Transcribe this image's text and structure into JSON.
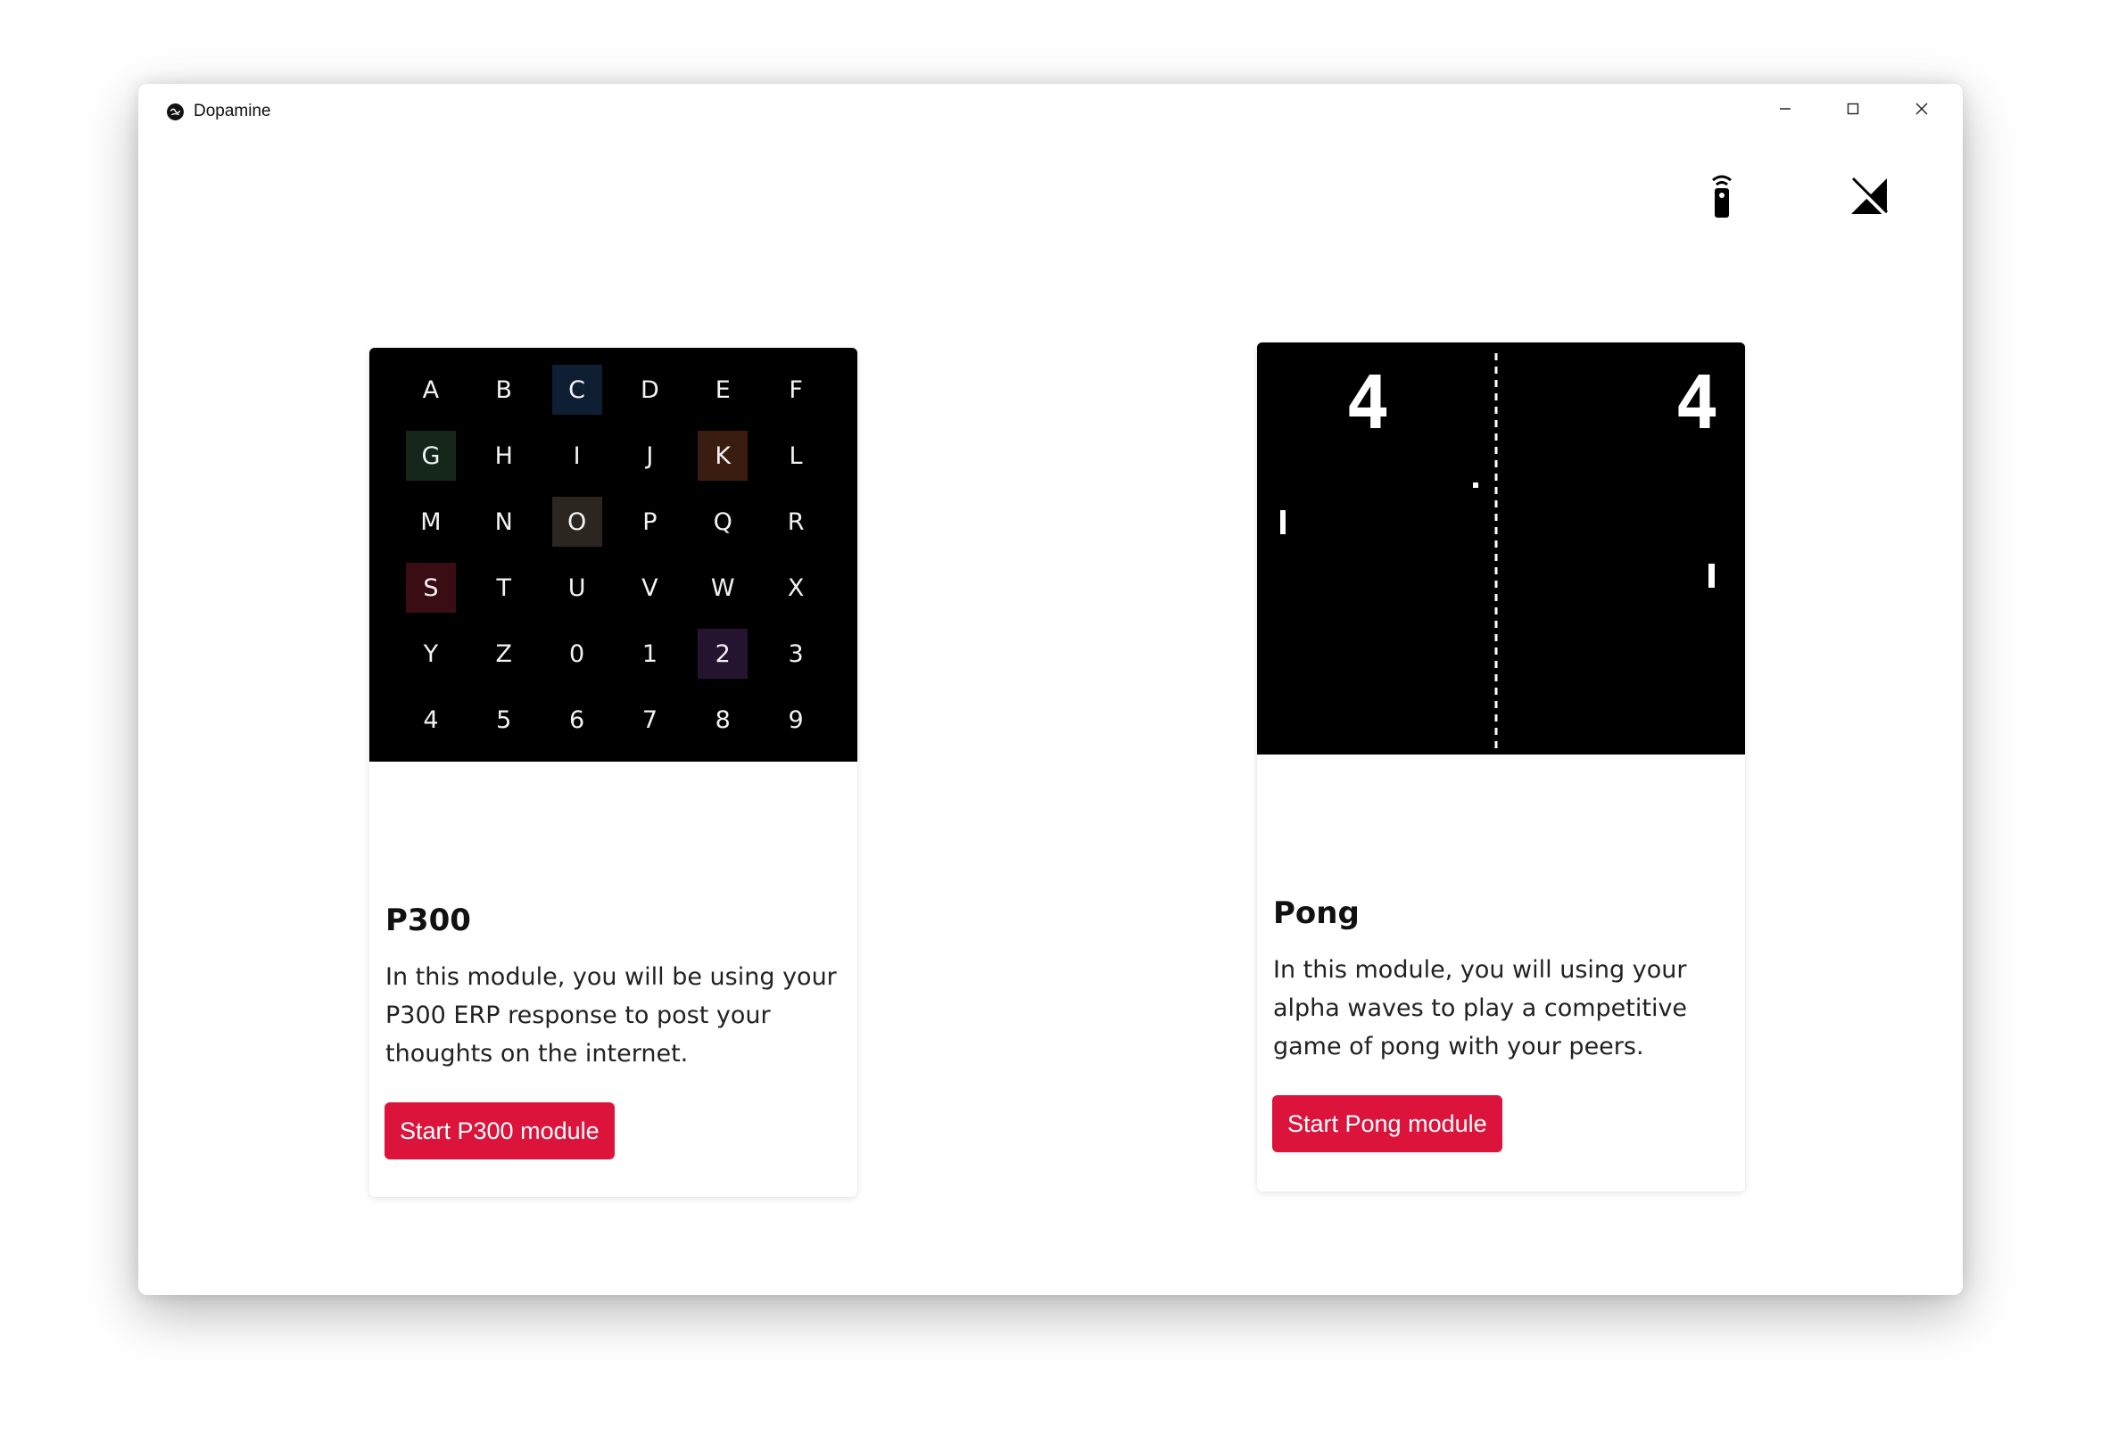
{
  "window": {
    "title": "Dopamine"
  },
  "toolbar": {
    "remote_icon": "remote-control-icon",
    "signal_icon": "no-signal-icon"
  },
  "modules": [
    {
      "title": "P300",
      "description": "In this module, you will be using your P300 ERP response to post your thoughts on the internet.",
      "button_label": "Start P300 module",
      "speller": {
        "cells": [
          "A",
          "B",
          "C",
          "D",
          "E",
          "F",
          "G",
          "H",
          "I",
          "J",
          "K",
          "L",
          "M",
          "N",
          "O",
          "P",
          "Q",
          "R",
          "S",
          "T",
          "U",
          "V",
          "W",
          "X",
          "Y",
          "Z",
          "0",
          "1",
          "2",
          "3",
          "4",
          "5",
          "6",
          "7",
          "8",
          "9"
        ],
        "highlights": {
          "C": "#0f1f33",
          "G": "#14271a",
          "K": "#3a1c10",
          "O": "#2b2620",
          "S": "#3a0c14",
          "2": "#251430"
        }
      }
    },
    {
      "title": "Pong",
      "description": "In this module, you will using your alpha waves to play a competitive game of pong with your peers.",
      "button_label": "Start Pong module",
      "game": {
        "left_score": "4",
        "right_score": "4"
      }
    }
  ],
  "colors": {
    "accent": "#dc143c",
    "screen_bg": "#000000"
  }
}
